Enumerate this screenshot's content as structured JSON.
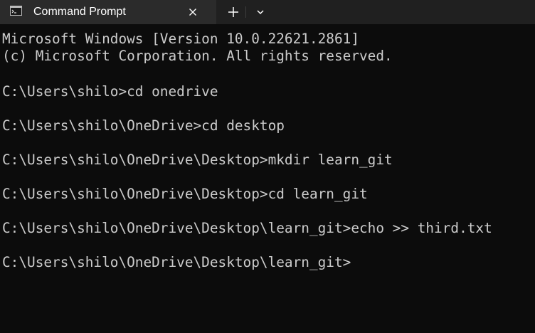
{
  "window": {
    "tab_title": "Command Prompt",
    "tab_icon": "terminal-icon",
    "close_icon": "close-icon",
    "new_tab_icon": "plus-icon",
    "dropdown_icon": "chevron-down-icon"
  },
  "terminal": {
    "lines": [
      "Microsoft Windows [Version 10.0.22621.2861]",
      "(c) Microsoft Corporation. All rights reserved.",
      "",
      "C:\\Users\\shilo>cd onedrive",
      "",
      "C:\\Users\\shilo\\OneDrive>cd desktop",
      "",
      "C:\\Users\\shilo\\OneDrive\\Desktop>mkdir learn_git",
      "",
      "C:\\Users\\shilo\\OneDrive\\Desktop>cd learn_git",
      "",
      "C:\\Users\\shilo\\OneDrive\\Desktop\\learn_git>echo >> third.txt",
      "",
      "C:\\Users\\shilo\\OneDrive\\Desktop\\learn_git>"
    ]
  },
  "colors": {
    "background": "#0c0c0c",
    "foreground": "#cccccc",
    "titlebar": "#202020",
    "active_tab": "#2b2b2b"
  }
}
